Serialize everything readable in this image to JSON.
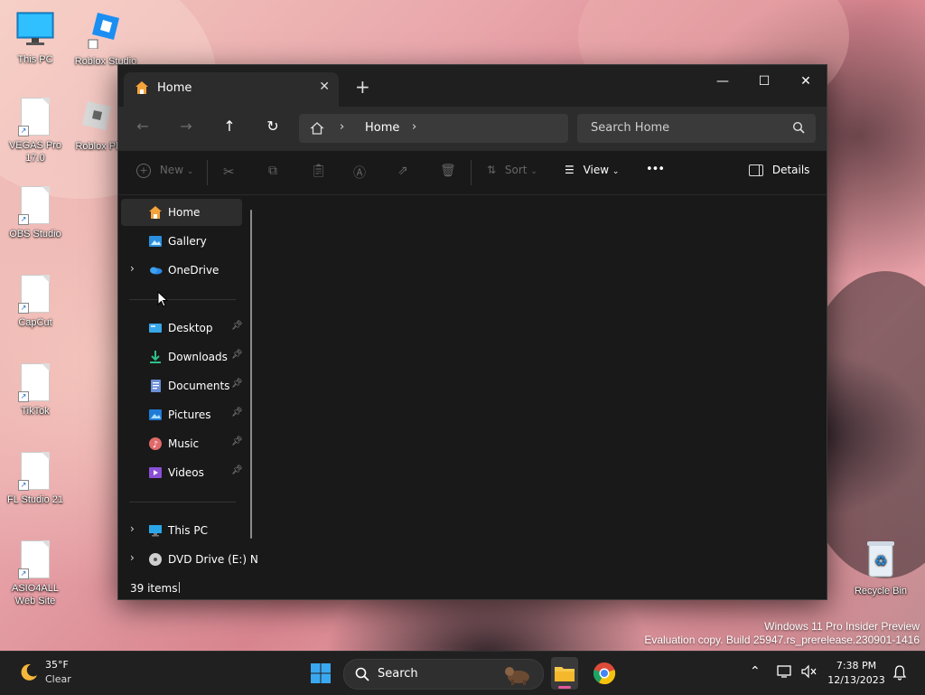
{
  "desktop": {
    "icons": [
      {
        "label": "This PC",
        "icon": "monitor-icon"
      },
      {
        "label": "Roblox Studio",
        "icon": "roblox-studio-icon"
      },
      {
        "label": "VEGAS Pro 17.0",
        "icon": "file-shortcut-icon"
      },
      {
        "label": "Roblox Pl",
        "icon": "roblox-player-icon"
      },
      {
        "label": "OBS Studio",
        "icon": "file-shortcut-icon"
      },
      {
        "label": "CapCut",
        "icon": "file-shortcut-icon"
      },
      {
        "label": "TikTok",
        "icon": "file-shortcut-icon"
      },
      {
        "label": "FL Studio 21",
        "icon": "file-shortcut-icon"
      },
      {
        "label": "ASIO4ALL Web Site",
        "icon": "file-shortcut-icon"
      },
      {
        "label": "Recycle Bin",
        "icon": "recycle-bin-icon"
      }
    ],
    "watermark": {
      "line1": "Windows 11 Pro Insider Preview",
      "line2": "Evaluation copy. Build 25947.rs_prerelease.230901-1416"
    }
  },
  "explorer": {
    "tab": {
      "label": "Home",
      "close": "✕"
    },
    "new_tab": "+",
    "window_controls": {
      "minimize": "—",
      "maximize": "☐",
      "close": "✕"
    },
    "address": {
      "crumb": "Home"
    },
    "search": {
      "placeholder": "Search Home"
    },
    "command_bar": {
      "new_label": "New",
      "sort_label": "Sort",
      "view_label": "View",
      "more_label": "•••",
      "details_label": "Details"
    },
    "sidebar": {
      "top": [
        {
          "label": "Home",
          "icon": "home-icon",
          "selected": true
        },
        {
          "label": "Gallery",
          "icon": "gallery-icon"
        },
        {
          "label": "OneDrive",
          "icon": "onedrive-icon",
          "expandable": true
        }
      ],
      "pinned": [
        {
          "label": "Desktop",
          "icon": "desktop-folder-icon"
        },
        {
          "label": "Downloads",
          "icon": "downloads-icon"
        },
        {
          "label": "Documents",
          "icon": "documents-icon"
        },
        {
          "label": "Pictures",
          "icon": "pictures-icon"
        },
        {
          "label": "Music",
          "icon": "music-icon"
        },
        {
          "label": "Videos",
          "icon": "videos-icon"
        }
      ],
      "bottom": [
        {
          "label": "This PC",
          "icon": "this-pc-icon",
          "expandable": true
        },
        {
          "label": "DVD Drive (E:) N",
          "icon": "dvd-drive-icon",
          "expandable": true
        }
      ]
    },
    "status": {
      "items": "39 items"
    }
  },
  "taskbar": {
    "weather": {
      "temp": "35°F",
      "condition": "Clear"
    },
    "search_label": "Search",
    "clock": {
      "time": "7:38 PM",
      "date": "12/13/2023"
    }
  },
  "colors": {
    "window_bg": "#191919",
    "titlebar_bg": "#1f1f1f",
    "accent_folder": "#f6c94b",
    "taskbar_bg": "#202020"
  }
}
